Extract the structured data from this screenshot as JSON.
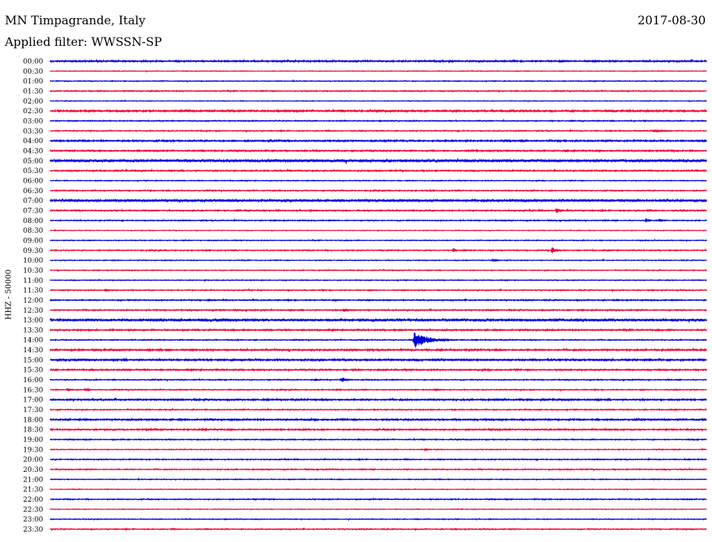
{
  "header": {
    "station": "MN Timpagrande, Italy",
    "date": "2017-08-30",
    "filter": "Applied filter: WWSSN-SP"
  },
  "colors": {
    "even_row": "#0000dd",
    "odd_row": "#ee0033"
  },
  "chart_data": {
    "type": "line",
    "title": "MN Timpagrande, Italy",
    "subtitle": "Applied filter: WWSSN-SP",
    "ylabel": "HHZ - 50000",
    "xlabel": "",
    "grid": false,
    "row_labels": [
      "00:00",
      "00:30",
      "01:00",
      "01:30",
      "02:00",
      "02:30",
      "03:00",
      "03:30",
      "04:00",
      "04:30",
      "05:00",
      "05:30",
      "06:00",
      "06:30",
      "07:00",
      "07:30",
      "08:00",
      "08:30",
      "09:00",
      "09:30",
      "10:00",
      "10:30",
      "11:00",
      "11:30",
      "12:00",
      "12:30",
      "13:00",
      "13:30",
      "14:00",
      "14:30",
      "15:00",
      "15:30",
      "16:00",
      "16:30",
      "17:00",
      "17:30",
      "18:00",
      "18:30",
      "19:00",
      "19:30",
      "20:00",
      "20:30",
      "21:00",
      "21:30",
      "22:00",
      "22:30",
      "23:00",
      "23:30"
    ],
    "row_minutes": 30,
    "noise_level": [
      0.9,
      0.4,
      0.5,
      0.6,
      0.4,
      1.0,
      0.6,
      0.6,
      0.9,
      0.8,
      1.4,
      0.7,
      0.5,
      0.6,
      1.2,
      0.7,
      0.6,
      0.4,
      0.5,
      0.6,
      0.5,
      0.5,
      0.5,
      0.6,
      0.7,
      0.7,
      1.2,
      0.8,
      0.6,
      0.9,
      1.0,
      0.8,
      0.6,
      0.6,
      0.9,
      0.6,
      0.9,
      0.8,
      0.6,
      0.5,
      0.6,
      0.6,
      0.5,
      0.4,
      0.6,
      0.4,
      0.5,
      0.6
    ],
    "events": [
      {
        "row": "03:30",
        "minute": 27.5,
        "amplitude": 2,
        "duration": 2
      },
      {
        "row": "03:30",
        "minute": 30,
        "amplitude": 2,
        "duration": 0.3
      },
      {
        "row": "04:30",
        "minute": 23.5,
        "amplitude": 3,
        "duration": 0.4
      },
      {
        "row": "05:00",
        "minute": 11.5,
        "amplitude": 2,
        "duration": 1.5
      },
      {
        "row": "05:30",
        "minute": 23,
        "amplitude": 2,
        "duration": 0.4
      },
      {
        "row": "05:30",
        "minute": 29.5,
        "amplitude": 2,
        "duration": 0.3
      },
      {
        "row": "07:00",
        "minute": 7.5,
        "amplitude": 2,
        "duration": 2
      },
      {
        "row": "07:00",
        "minute": 15.5,
        "amplitude": 2,
        "duration": 2
      },
      {
        "row": "07:00",
        "minute": 21.5,
        "amplitude": 2,
        "duration": 2
      },
      {
        "row": "07:30",
        "minute": 23.1,
        "amplitude": 5,
        "duration": 0.5
      },
      {
        "row": "08:00",
        "minute": 27.2,
        "amplitude": 5,
        "duration": 0.3
      },
      {
        "row": "08:00",
        "minute": 27.8,
        "amplitude": 3,
        "duration": 0.4
      },
      {
        "row": "08:30",
        "minute": 0.2,
        "amplitude": 2,
        "duration": 0.2
      },
      {
        "row": "09:30",
        "minute": 18.4,
        "amplitude": 5,
        "duration": 0.3
      },
      {
        "row": "09:30",
        "minute": 18.9,
        "amplitude": 2,
        "duration": 0.3
      },
      {
        "row": "09:30",
        "minute": 22.9,
        "amplitude": 6,
        "duration": 0.5
      },
      {
        "row": "10:00",
        "minute": 20.2,
        "amplitude": 2,
        "duration": 0.8
      },
      {
        "row": "11:30",
        "minute": 2.5,
        "amplitude": 2,
        "duration": 0.8
      },
      {
        "row": "12:00",
        "minute": 7.2,
        "amplitude": 2,
        "duration": 0.5
      },
      {
        "row": "12:30",
        "minute": 13.4,
        "amplitude": 4,
        "duration": 0.5
      },
      {
        "row": "14:00",
        "minute": 16.6,
        "amplitude": 13,
        "duration": 2
      },
      {
        "row": "14:30",
        "minute": 5.3,
        "amplitude": 3,
        "duration": 0.5
      },
      {
        "row": "16:00",
        "minute": 12.1,
        "amplitude": 3,
        "duration": 0.3
      },
      {
        "row": "16:00",
        "minute": 13.3,
        "amplitude": 5,
        "duration": 0.6
      },
      {
        "row": "16:30",
        "minute": 0.8,
        "amplitude": 3,
        "duration": 0.3
      },
      {
        "row": "16:30",
        "minute": 1.6,
        "amplitude": 3,
        "duration": 0.5
      },
      {
        "row": "16:30",
        "minute": 17.6,
        "amplitude": 3,
        "duration": 0.3
      },
      {
        "row": "19:30",
        "minute": 17.1,
        "amplitude": 3,
        "duration": 0.4
      },
      {
        "row": "20:00",
        "minute": 7.3,
        "amplitude": 1.5,
        "duration": 0.3
      }
    ]
  }
}
